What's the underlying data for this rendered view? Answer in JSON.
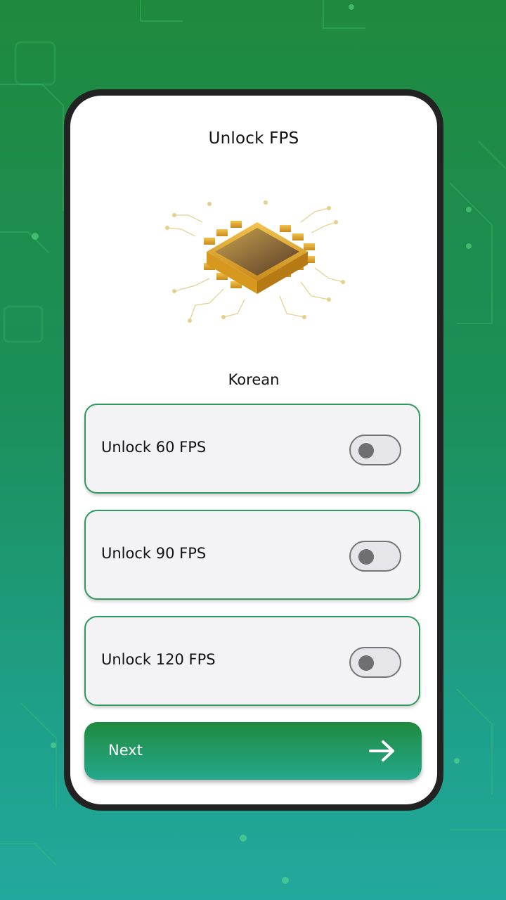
{
  "screen": {
    "title": "Unlock FPS",
    "language": "Korean"
  },
  "options": [
    {
      "label": "Unlock 60 FPS",
      "enabled": false
    },
    {
      "label": "Unlock 90 FPS",
      "enabled": false
    },
    {
      "label": "Unlock 120 FPS",
      "enabled": false
    }
  ],
  "next_button": {
    "label": "Next",
    "icon": "arrow-right-icon"
  },
  "colors": {
    "accent": "#1f8a3e",
    "accent_teal": "#25a88e",
    "card_border": "#2e9a5e",
    "toggle_off": "#6f6e73"
  },
  "illustration": {
    "icon": "cpu-chip-icon"
  }
}
